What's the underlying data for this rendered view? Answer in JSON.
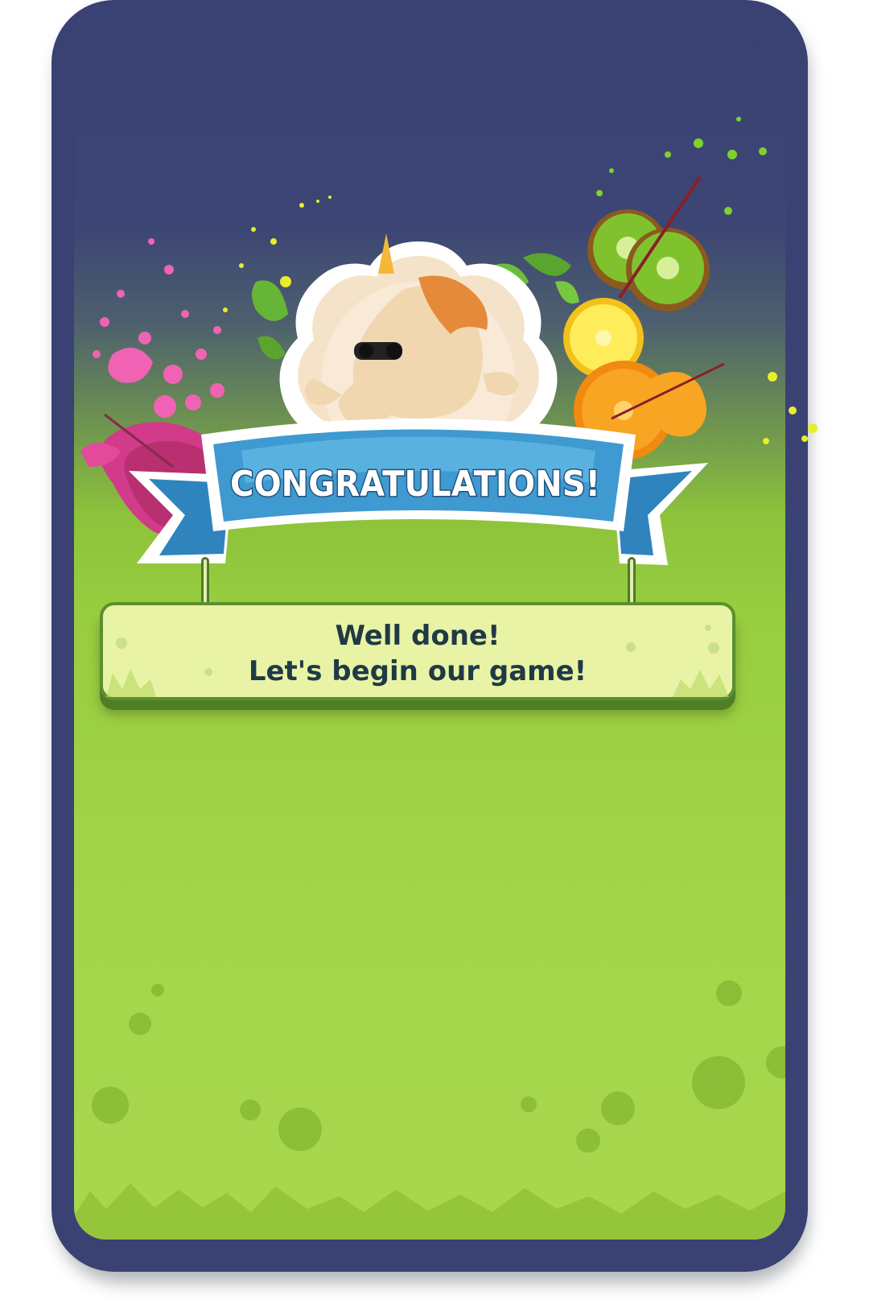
{
  "banner": {
    "title": "CONGRATULATIONS!"
  },
  "message": {
    "line1": "Well done!",
    "line2": "Let's begin our game!"
  },
  "mascot": {
    "character": "unicorn-with-sunglasses"
  },
  "decorations": {
    "fruits": [
      "kiwi",
      "lemon",
      "orange",
      "dragon-fruit"
    ],
    "leaves": "green-leaves"
  },
  "colors": {
    "frame": "#3a4273",
    "ribbon": "#3e9ad0",
    "panel": "#e9f3a6",
    "text": "#1f3a45",
    "grass": "#a5d64a"
  }
}
